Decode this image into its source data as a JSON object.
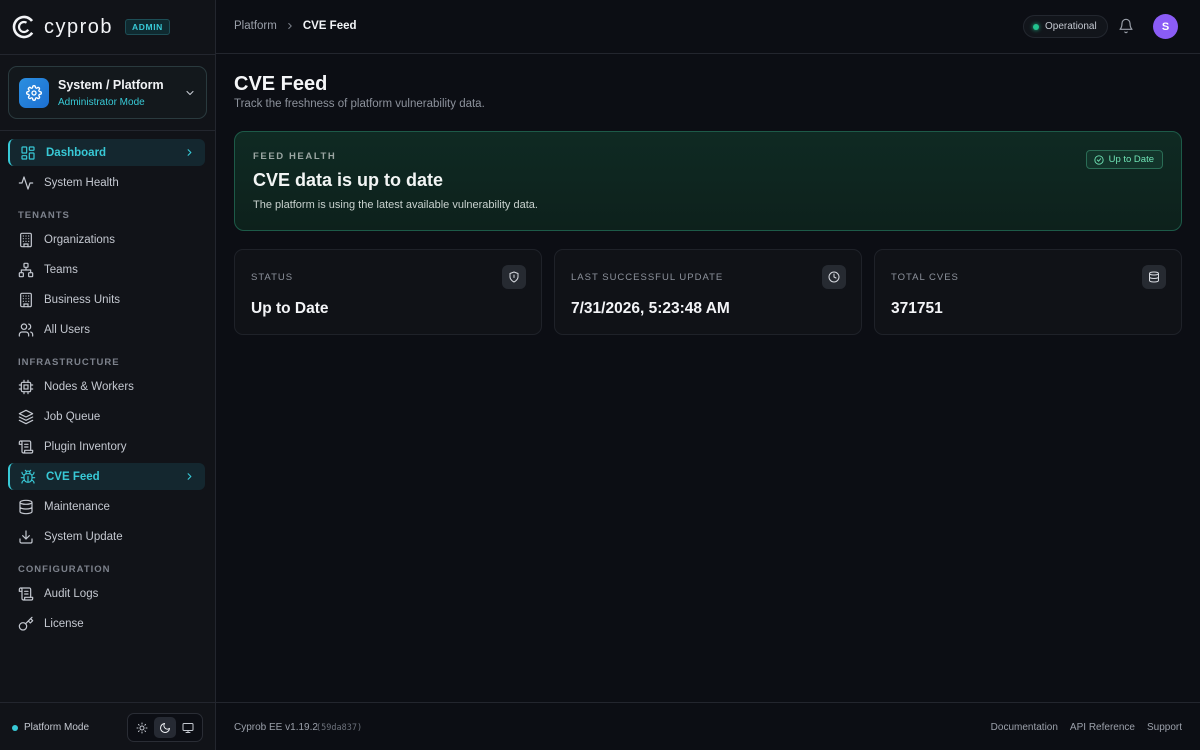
{
  "brand": {
    "name": "cyprob",
    "badge": "ADMIN"
  },
  "context": {
    "title": "System / Platform",
    "subtitle": "Administrator Mode"
  },
  "sidebar": {
    "items": [
      {
        "label": "Dashboard",
        "icon": "dashboard-icon",
        "active": true
      },
      {
        "label": "System Health",
        "icon": "activity-icon"
      },
      {
        "label": "Organizations",
        "icon": "building-icon"
      },
      {
        "label": "Teams",
        "icon": "network-icon"
      },
      {
        "label": "Business Units",
        "icon": "building-icon"
      },
      {
        "label": "All Users",
        "icon": "users-icon"
      },
      {
        "label": "Nodes & Workers",
        "icon": "cpu-icon"
      },
      {
        "label": "Job Queue",
        "icon": "layers-icon"
      },
      {
        "label": "Plugin Inventory",
        "icon": "scroll-icon"
      },
      {
        "label": "CVE Feed",
        "icon": "bug-icon",
        "active": true
      },
      {
        "label": "Maintenance",
        "icon": "database-icon"
      },
      {
        "label": "System Update",
        "icon": "download-icon"
      },
      {
        "label": "Audit Logs",
        "icon": "scroll-icon"
      },
      {
        "label": "License",
        "icon": "key-icon"
      }
    ],
    "sections": {
      "tenants": "TENANTS",
      "infrastructure": "INFRASTRUCTURE",
      "configuration": "CONFIGURATION"
    },
    "footer": {
      "mode_label": "Platform Mode"
    }
  },
  "topbar": {
    "breadcrumb": {
      "root": "Platform",
      "current": "CVE Feed"
    },
    "status": "Operational",
    "avatar_initial": "S"
  },
  "page": {
    "title": "CVE Feed",
    "subtitle": "Track the freshness of platform vulnerability data."
  },
  "health": {
    "eyebrow": "FEED HEALTH",
    "title": "CVE data is up to date",
    "description": "The platform is using the latest available vulnerability data.",
    "badge": "Up to Date"
  },
  "stats": [
    {
      "label": "STATUS",
      "value": "Up to Date",
      "icon": "shield-icon"
    },
    {
      "label": "LAST SUCCESSFUL UPDATE",
      "value": "7/31/2026, 5:23:48 AM",
      "icon": "clock-icon"
    },
    {
      "label": "TOTAL CVES",
      "value": "371751",
      "icon": "database-icon"
    }
  ],
  "footer": {
    "version": "Cyprob EE v1.19.2",
    "commit": "(59da837)",
    "links": [
      "Documentation",
      "API Reference",
      "Support"
    ]
  },
  "colors": {
    "accent": "#38c9d6",
    "success": "#22c38e",
    "background": "#0c0e14",
    "avatar": "#8b5cf6"
  }
}
